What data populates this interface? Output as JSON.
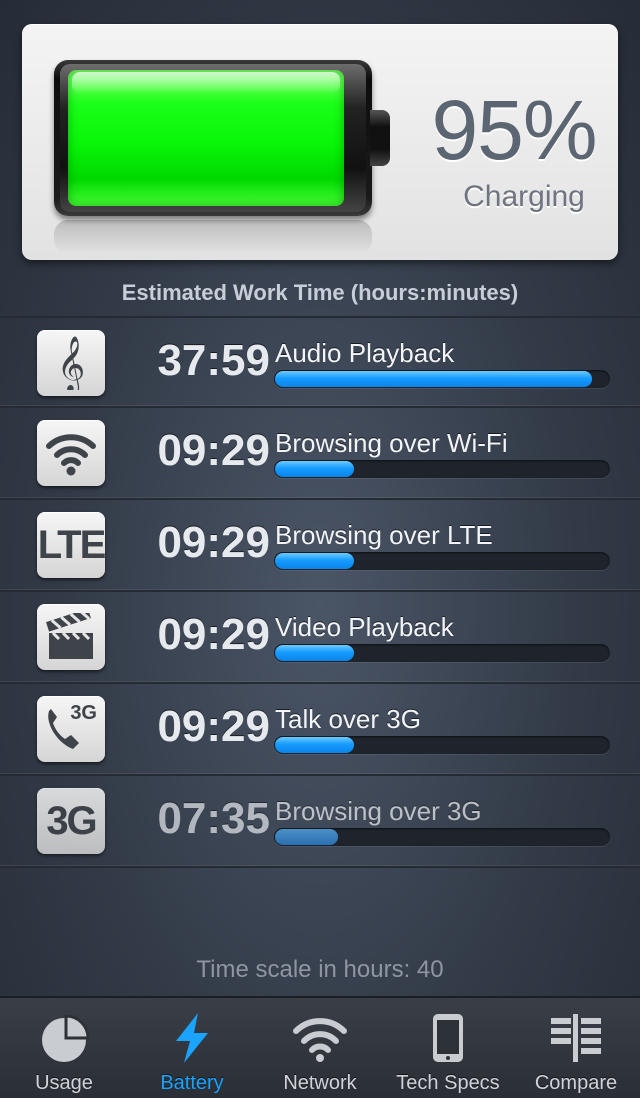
{
  "battery": {
    "percent_label": "95%",
    "level": 0.95,
    "status": "Charging",
    "fill_color": "#13ff13"
  },
  "estimated_title": "Estimated Work Time (hours:minutes)",
  "rows": [
    {
      "icon": "treble-clef-icon",
      "time": "37:59",
      "label": "Audio Playback",
      "hours": 37.98
    },
    {
      "icon": "wifi-icon",
      "time": "09:29",
      "label": "Browsing over Wi-Fi",
      "hours": 9.48
    },
    {
      "icon": "lte-icon",
      "icon_text": "LTE",
      "time": "09:29",
      "label": "Browsing over LTE",
      "hours": 9.48
    },
    {
      "icon": "clapperboard-icon",
      "time": "09:29",
      "label": "Video Playback",
      "hours": 9.48
    },
    {
      "icon": "phone-3g-icon",
      "icon_text": "3G",
      "time": "09:29",
      "label": "Talk over 3G",
      "hours": 9.48
    },
    {
      "icon": "3g-icon",
      "icon_text": "3G",
      "time": "07:35",
      "label": "Browsing over 3G",
      "hours": 7.58
    }
  ],
  "time_scale": {
    "label": "Time scale in hours: 40",
    "max_hours": 40
  },
  "accent_color": "#1aa3ff",
  "tabs": [
    {
      "label": "Usage",
      "icon": "pie-chart-icon",
      "active": false
    },
    {
      "label": "Battery",
      "icon": "lightning-bolt-icon",
      "active": true
    },
    {
      "label": "Network",
      "icon": "wifi-icon",
      "active": false
    },
    {
      "label": "Tech Specs",
      "icon": "phone-outline-icon",
      "active": false
    },
    {
      "label": "Compare",
      "icon": "compare-columns-icon",
      "active": false
    }
  ]
}
